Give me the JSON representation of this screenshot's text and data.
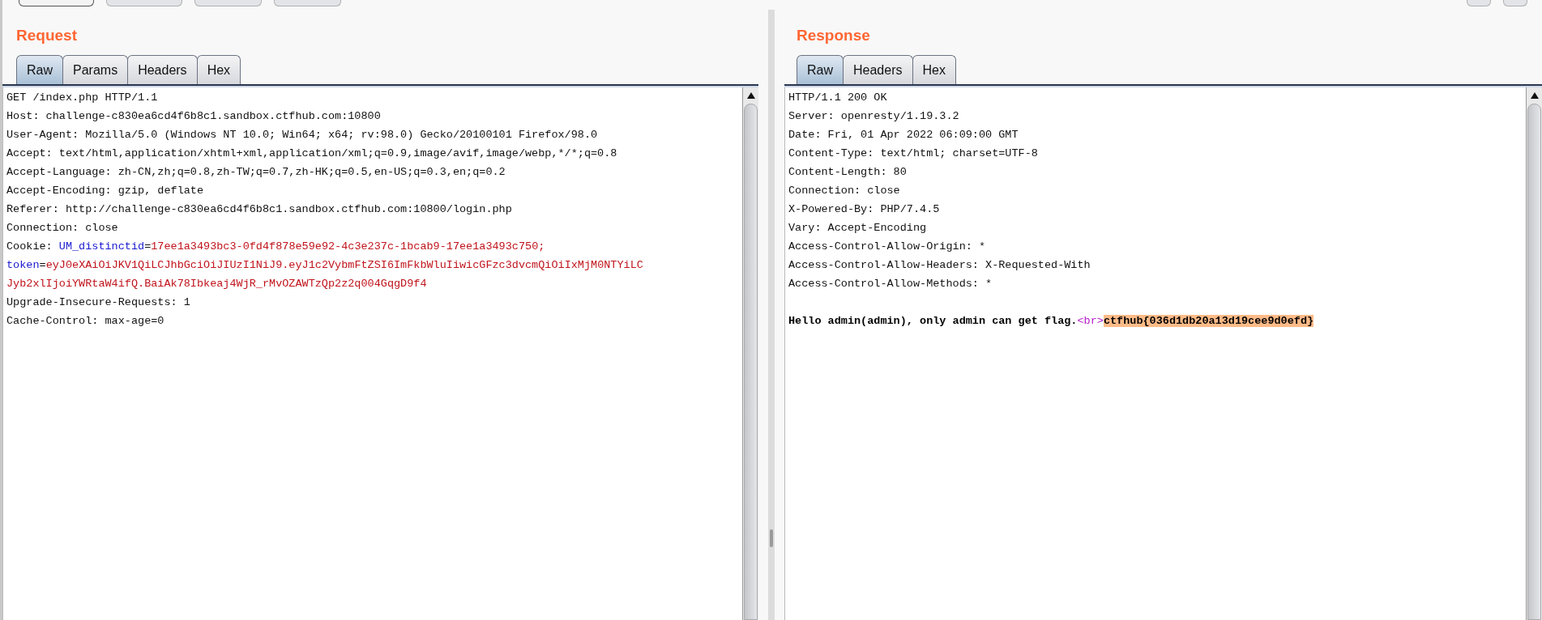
{
  "request": {
    "title": "Request",
    "tabs": [
      {
        "label": "Raw",
        "selected": true
      },
      {
        "label": "Params",
        "selected": false
      },
      {
        "label": "Headers",
        "selected": false
      },
      {
        "label": "Hex",
        "selected": false
      }
    ],
    "lines": [
      [
        {
          "text": "GET /index.php HTTP/1.1",
          "kind": "plain"
        }
      ],
      [
        {
          "text": "Host: challenge-c830ea6cd4f6b8c1.sandbox.ctfhub.com:10800",
          "kind": "plain"
        }
      ],
      [
        {
          "text": "User-Agent: Mozilla/5.0 (Windows NT 10.0; Win64; x64; rv:98.0) Gecko/20100101 Firefox/98.0",
          "kind": "plain"
        }
      ],
      [
        {
          "text": "Accept: text/html,application/xhtml+xml,application/xml;q=0.9,image/avif,image/webp,*/*;q=0.8",
          "kind": "plain"
        }
      ],
      [
        {
          "text": "Accept-Language: zh-CN,zh;q=0.8,zh-TW;q=0.7,zh-HK;q=0.5,en-US;q=0.3,en;q=0.2",
          "kind": "plain"
        }
      ],
      [
        {
          "text": "Accept-Encoding: gzip, deflate",
          "kind": "plain"
        }
      ],
      [
        {
          "text": "Referer: http://challenge-c830ea6cd4f6b8c1.sandbox.ctfhub.com:10800/login.php",
          "kind": "plain"
        }
      ],
      [
        {
          "text": "Connection: close",
          "kind": "plain"
        }
      ],
      [
        {
          "text": "Cookie: ",
          "kind": "plain"
        },
        {
          "text": "UM_distinctid",
          "kind": "name"
        },
        {
          "text": "=",
          "kind": "plain"
        },
        {
          "text": "17ee1a3493bc3-0fd4f878e59e92-4c3e237c-1bcab9-17ee1a3493c750;",
          "kind": "value"
        }
      ],
      [
        {
          "text": "token",
          "kind": "name"
        },
        {
          "text": "=",
          "kind": "plain"
        },
        {
          "text": "eyJ0eXAiOiJKV1QiLCJhbGciOiJIUzI1NiJ9.eyJ1c2VybmFtZSI6ImFkbWluIiwicGFzc3dvcmQiOiIxMjM0NTYiLC",
          "kind": "value"
        }
      ],
      [
        {
          "text": "Jyb2xlIjoiYWRtaW4ifQ.BaiAk78Ibkeaj4WjR_rMvOZAWTzQp2z2q004GqgD9f4",
          "kind": "value"
        }
      ],
      [
        {
          "text": "Upgrade-Insecure-Requests: 1",
          "kind": "plain"
        }
      ],
      [
        {
          "text": "Cache-Control: max-age=0",
          "kind": "plain"
        }
      ]
    ]
  },
  "response": {
    "title": "Response",
    "tabs": [
      {
        "label": "Raw",
        "selected": true
      },
      {
        "label": "Headers",
        "selected": false
      },
      {
        "label": "Hex",
        "selected": false
      }
    ],
    "lines": [
      [
        {
          "text": "HTTP/1.1 200 OK",
          "kind": "plain"
        }
      ],
      [
        {
          "text": "Server: openresty/1.19.3.2",
          "kind": "plain"
        }
      ],
      [
        {
          "text": "Date: Fri, 01 Apr 2022 06:09:00 GMT",
          "kind": "plain"
        }
      ],
      [
        {
          "text": "Content-Type: text/html; charset=UTF-8",
          "kind": "plain"
        }
      ],
      [
        {
          "text": "Content-Length: 80",
          "kind": "plain"
        }
      ],
      [
        {
          "text": "Connection: close",
          "kind": "plain"
        }
      ],
      [
        {
          "text": "X-Powered-By: PHP/7.4.5",
          "kind": "plain"
        }
      ],
      [
        {
          "text": "Vary: Accept-Encoding",
          "kind": "plain"
        }
      ],
      [
        {
          "text": "Access-Control-Allow-Origin: *",
          "kind": "plain"
        }
      ],
      [
        {
          "text": "Access-Control-Allow-Headers: X-Requested-With",
          "kind": "plain"
        }
      ],
      [
        {
          "text": "Access-Control-Allow-Methods: *",
          "kind": "plain"
        }
      ],
      [
        {
          "text": "Hello admin(admin), only admin can get flag.",
          "kind": "body"
        },
        {
          "text": "<br>",
          "kind": "tag"
        },
        {
          "text": "ctfhub{036d1db20a13d19cee9d0efd}",
          "kind": "highlight"
        }
      ]
    ]
  }
}
